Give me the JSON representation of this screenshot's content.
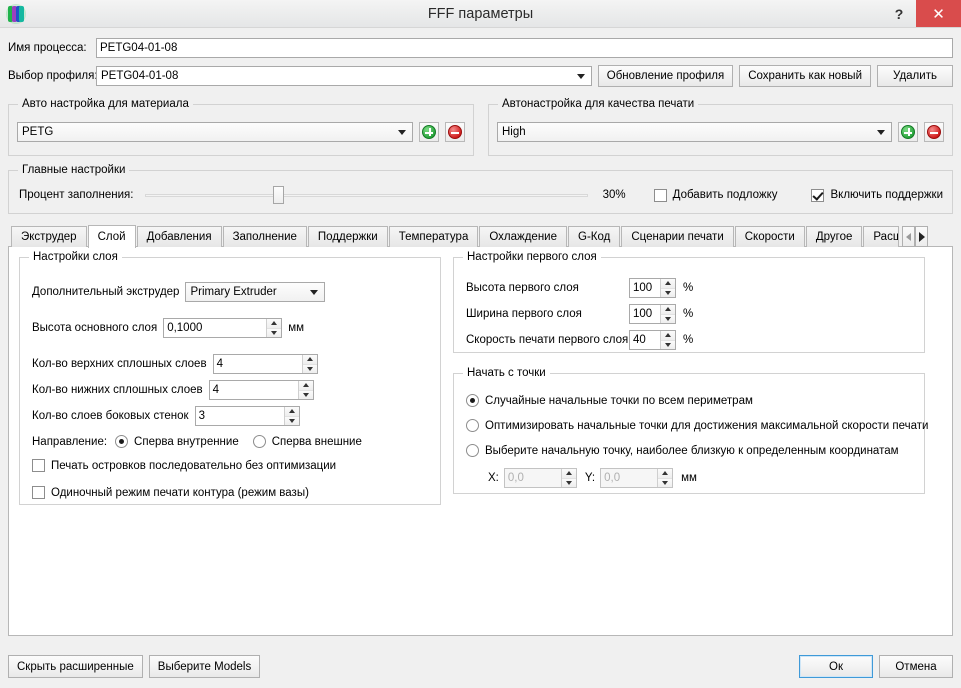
{
  "window": {
    "title": "FFF параметры",
    "help_label": "?",
    "close_label": "✕",
    "app_icon": "extruder-icon"
  },
  "process": {
    "name_label": "Имя процесса:",
    "name_value": "PETG04-01-08",
    "profile_label": "Выбор профиля:",
    "profile_value": "PETG04-01-08",
    "update_profile_button": "Обновление профиля",
    "save_as_new_button": "Сохранить как новый",
    "delete_button": "Удалить"
  },
  "material_group": {
    "title": "Авто настройка для материала",
    "selected": "PETG",
    "add_button": "+",
    "remove_button": "−"
  },
  "quality_group": {
    "title": "Автонастройка для качества печати",
    "selected": "High",
    "add_button": "+",
    "remove_button": "−"
  },
  "main_settings": {
    "title": "Главные настройки",
    "infill_label": "Процент заполнения:",
    "infill_value": "30%",
    "infill_percent": 30,
    "raft_label": "Добавить подложку",
    "raft_checked": false,
    "support_label": "Включить поддержки",
    "support_checked": true
  },
  "tabs": [
    {
      "label": "Экструдер",
      "active": false
    },
    {
      "label": "Слой",
      "active": true
    },
    {
      "label": "Добавления",
      "active": false
    },
    {
      "label": "Заполнение",
      "active": false
    },
    {
      "label": "Поддержки",
      "active": false
    },
    {
      "label": "Температура",
      "active": false
    },
    {
      "label": "Охлаждение",
      "active": false
    },
    {
      "label": "G-Код",
      "active": false
    },
    {
      "label": "Сценарии печати",
      "active": false
    },
    {
      "label": "Скорости",
      "active": false
    },
    {
      "label": "Другое",
      "active": false
    },
    {
      "label": "Расш",
      "active": false
    }
  ],
  "tab_scroll": {
    "left": "◀",
    "right": "▶"
  },
  "layer_settings": {
    "title": "Настройки слоя",
    "extruder_label": "Дополнительный экструдер",
    "extruder_value": "Primary Extruder",
    "layer_height_label": "Высота основного слоя",
    "layer_height_value": "0,1000",
    "layer_height_unit": "мм",
    "top_solid_label": "Кол-во верхних сплошных слоев",
    "top_solid_value": "4",
    "bottom_solid_label": "Кол-во нижних сплошных слоев",
    "bottom_solid_value": "4",
    "perimeter_label": "Кол-во слоев боковых стенок",
    "perimeter_value": "3",
    "direction_label": "Направление:",
    "dir_inner_label": "Сперва внутренние",
    "dir_inner_selected": true,
    "dir_outer_label": "Сперва внешние",
    "dir_outer_selected": false,
    "islands_label": "Печать островков последовательно без оптимизации",
    "islands_checked": false,
    "vase_label": "Одиночный режим печати контура (режим вазы)",
    "vase_checked": false
  },
  "first_layer": {
    "title": "Настройки первого слоя",
    "height_label": "Высота первого слоя",
    "height_value": "100",
    "height_unit": "%",
    "width_label": "Ширина первого слоя",
    "width_value": "100",
    "width_unit": "%",
    "speed_label": "Скорость печати первого слоя",
    "speed_value": "40",
    "speed_unit": "%"
  },
  "start_point": {
    "title": "Начать с точки",
    "opt_random": "Случайные начальные точки по всем периметрам",
    "opt_random_selected": true,
    "opt_optimize": "Оптимизировать начальные точки для достижения максимальной скорости печати",
    "opt_optimize_selected": false,
    "opt_coords": "Выберите начальную точку, наиболее близкую к определенным координатам",
    "opt_coords_selected": false,
    "x_label": "X:",
    "x_value": "0,0",
    "y_label": "Y:",
    "y_value": "0,0",
    "unit": "мм"
  },
  "footer": {
    "hide_advanced_button": "Скрыть расширенные",
    "select_models_button": "Выберите Models",
    "ok_button": "Ок",
    "cancel_button": "Отмена"
  },
  "colors": {
    "close_red": "#d94c4c",
    "accent_blue": "#3f9ad8",
    "add_green": "#1f9e34",
    "remove_red": "#cc1111"
  }
}
